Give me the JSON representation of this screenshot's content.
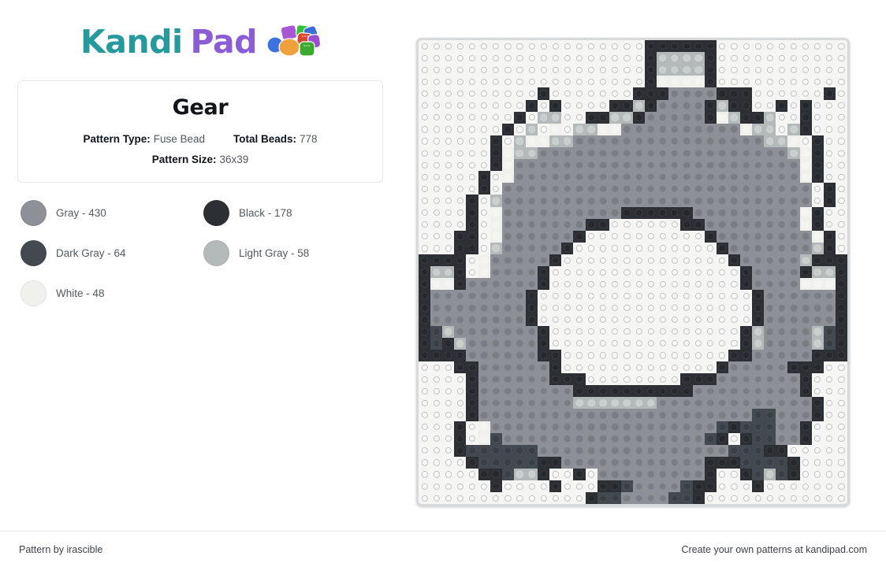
{
  "brand": {
    "name_part1": "Kandi",
    "name_part2": "Pad",
    "color_teal": "#25999b",
    "color_purple": "#8b5cd6",
    "logo_icon": "beads-cluster-icon"
  },
  "card": {
    "title": "Gear",
    "pattern_type_label": "Pattern Type:",
    "pattern_type_value": "Fuse Bead",
    "total_beads_label": "Total Beads:",
    "total_beads_value": "778",
    "pattern_size_label": "Pattern Size:",
    "pattern_size_value": "36x39"
  },
  "legend": [
    {
      "name": "Gray",
      "count": 430,
      "label": "Gray - 430",
      "hex": "#8d9197",
      "key": "G"
    },
    {
      "name": "Black",
      "count": 178,
      "label": "Black - 178",
      "hex": "#2c2f34",
      "key": "K"
    },
    {
      "name": "Dark Gray",
      "count": 64,
      "label": "Dark Gray - 64",
      "hex": "#434950",
      "key": "D"
    },
    {
      "name": "Light Gray",
      "count": 58,
      "label": "Light Gray - 58",
      "hex": "#b4bab9",
      "key": "L"
    },
    {
      "name": "White",
      "count": 48,
      "label": "White - 48",
      "hex": "#f0f1ec",
      "key": "W"
    }
  ],
  "board": {
    "cols": 36,
    "rows": 39,
    "empty_key": ".",
    "empty_hex": "#f5f5f4",
    "board_hex": "#d8d9db",
    "palette": {
      ".": "#f5f5f4",
      "G": "#8d9197",
      "K": "#2c2f34",
      "D": "#434950",
      "L": "#b4bab9",
      "W": "#f0f1ec"
    },
    "rows_data": [
      "...................KKKKKK...........",
      "...................KLLLLK...........",
      "...................KLLLLK...........",
      "...................KWWWWK...........",
      "..........K.......KKKGGGGKKK......K.",
      ".........K.K....KKLKGGGGKLKK..K.K...",
      "........K.LL..KKLLKGGGGGKWLKKL..K...",
      ".......K.L.W.LLWWGGGGGGGGGGWLL.LK...",
      "......K.LWWLLGGGGGGGGGGGGGGGGLLW.K..",
      "......KWLLGGGGGGGGGGGGGGGGGGGGGLWK..",
      "......KWGGGGGGGGGGGGGGGGGGGGGGGGWK..",
      ".....K.WGGGGGGGGGGGGGGGGGGGGGGGGWK..",
      ".....K.GGGGGGGGGGGGGGGGGGGGGGGGGG.K.",
      "....K.LGGGGGGGGGGGGGGGGGGGGGGGGGG.K.",
      "....K.WGGGGGGGGGGKKKKKKGGGGGGGGGWK..",
      "....K.WGGGGGGGKK......KKGGGGGGGGWK..",
      "...KK.WGGGGGGK..........KGGGGGGGGWK.",
      "...KK.LGGGGGK............KGGGGGGGLK.",
      "KKKK.WGGGGGK..............KGGGGGLKKK",
      "KLLK.WGGGGK................KGGGGKLLK",
      "KWWKGGGGGGK................KGGGGWWWK",
      "KGGGGGGGGK..................KGGGGGGK",
      "KGGGGGGGGK..................KGGGGGGK",
      "KGGGGGGGGK..................KGGGGGGK",
      "KDLGGGGGGGK................KLGGGGLDK",
      "KDKLGGGGGGK................KLGGGGLDK",
      "KKKKGGGGGGKK..............KKGGGGGKKK",
      "...KKGGGGGGK.............KGGGGGKKK..",
      "....KGGGGGGKKK........KKKGGGGGGGK...",
      "....KGGGGGGGGKKKKKKKKKKGGGGGGGGGK...",
      "....KGGGGGGGGLLLLLLLGGGGGGGGGGGGGK..",
      "....KGGGGGGGGGGGGGGGGGGGGGGGDDGGGK..",
      "...K.WGGGGGGGGGGGGGGGGGGGDKDDDGGK...",
      "...K.WDGGGGGGGGGGGGGGGGGDK.KDDGGK...",
      "...KDDDDDDGGGGGGGGGGGGGGGGDDDKK.....",
      "....KDDDDDKKGGGGGGGGGGGGKKKDDDDK....",
      ".....KKDLLK..K.GGGGGGGGGK..KDLDK....",
      "......K....K...KKDGGGGDKK...K.......",
      "..............KDDGGGGDDK............"
    ]
  },
  "footer": {
    "left": "Pattern by irascible",
    "right": "Create your own patterns at kandipad.com"
  }
}
